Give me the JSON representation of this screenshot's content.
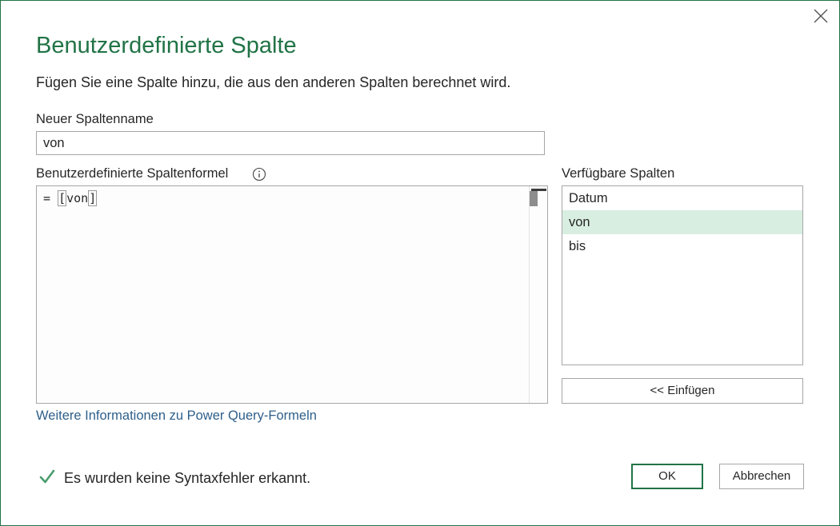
{
  "dialog": {
    "title": "Benutzerdefinierte Spalte",
    "subtitle": "Fügen Sie eine Spalte hinzu, die aus den anderen Spalten berechnet wird.",
    "close_icon": "close-icon"
  },
  "column_name": {
    "label": "Neuer Spaltenname",
    "value": "von"
  },
  "formula": {
    "label": "Benutzerdefinierte Spaltenformel",
    "info_icon": "info-icon",
    "prefix": "= ",
    "open_bracket": "[",
    "column": "von",
    "close_bracket": "]"
  },
  "available_columns": {
    "label": "Verfügbare Spalten",
    "items": [
      "Datum",
      "von",
      "bis"
    ],
    "selected": "von",
    "insert_label": "<< Einfügen"
  },
  "help_link": "Weitere Informationen zu Power Query-Formeln",
  "status": {
    "icon": "checkmark-icon",
    "text": "Es wurden keine Syntaxfehler erkannt.",
    "color": "#4a9c6d"
  },
  "buttons": {
    "ok": "OK",
    "cancel": "Abbrechen"
  },
  "colors": {
    "accent": "#217346",
    "selection": "#d8eee1",
    "link": "#2f5f8a"
  }
}
